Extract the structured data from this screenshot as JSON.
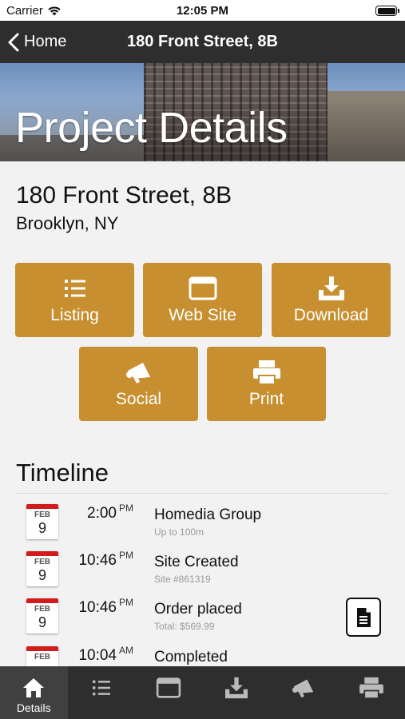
{
  "status_bar": {
    "carrier": "Carrier",
    "time": "12:05 PM"
  },
  "nav": {
    "back_label": "Home",
    "title": "180 Front Street, 8B"
  },
  "hero": {
    "title": "Project Details"
  },
  "address": {
    "street": "180 Front Street, 8B",
    "city": "Brooklyn, NY"
  },
  "actions": [
    {
      "label": "Listing",
      "icon": "list-icon"
    },
    {
      "label": "Web Site",
      "icon": "browser-window-icon"
    },
    {
      "label": "Download",
      "icon": "download-icon"
    },
    {
      "label": "Social",
      "icon": "megaphone-icon"
    },
    {
      "label": "Print",
      "icon": "printer-icon"
    }
  ],
  "timeline": {
    "title": "Timeline",
    "items": [
      {
        "month": "FEB",
        "day": "9",
        "time": "2:00",
        "ampm": "PM",
        "title": "Homedia Group",
        "subtitle": "Up to 100m"
      },
      {
        "month": "FEB",
        "day": "9",
        "time": "10:46",
        "ampm": "PM",
        "title": "Site Created",
        "subtitle": "Site #861319"
      },
      {
        "month": "FEB",
        "day": "9",
        "time": "10:46",
        "ampm": "PM",
        "title": "Order placed",
        "subtitle": "Total: $569.99"
      },
      {
        "month": "FEB",
        "day": "",
        "time": "10:04",
        "ampm": "AM",
        "title": "Completed",
        "subtitle": ""
      }
    ]
  },
  "tabbar": {
    "items": [
      {
        "label": "Details",
        "icon": "home-icon",
        "active": true
      },
      {
        "label": "",
        "icon": "list-icon"
      },
      {
        "label": "",
        "icon": "browser-window-icon"
      },
      {
        "label": "",
        "icon": "download-icon"
      },
      {
        "label": "",
        "icon": "megaphone-icon"
      },
      {
        "label": "",
        "icon": "printer-icon"
      }
    ]
  },
  "colors": {
    "accent": "#c78f2f",
    "navbar": "#2e2e2e",
    "background": "#f2f2f2",
    "calendar_red": "#d21c1c"
  }
}
